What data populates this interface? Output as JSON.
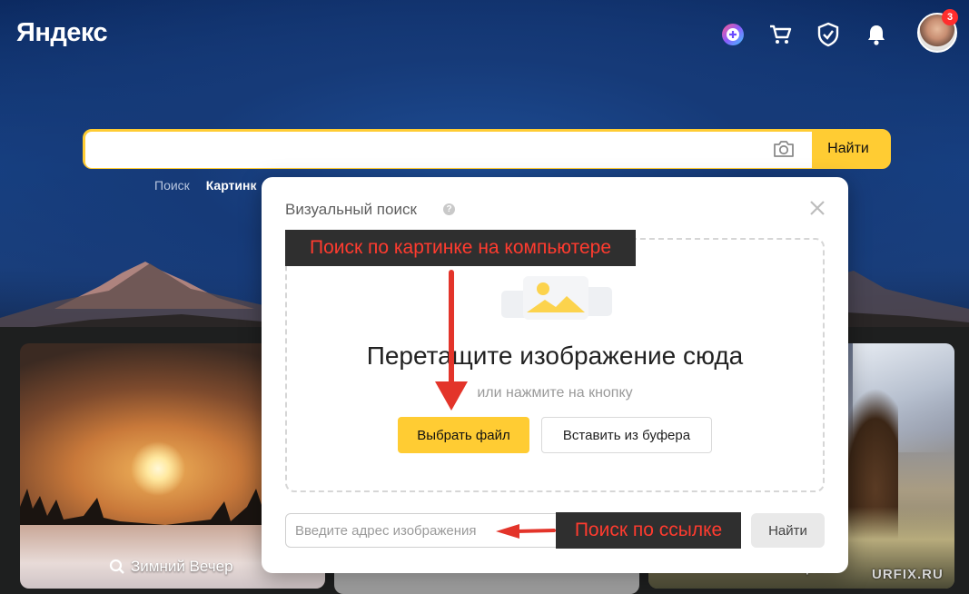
{
  "header": {
    "logo": "Яндекс",
    "icons": [
      "plus-circle-icon",
      "cart-icon",
      "shield-check-icon",
      "bell-icon"
    ],
    "notifications_count": "3"
  },
  "search": {
    "button_label": "Найти",
    "placeholder": ""
  },
  "tabs": [
    {
      "label": "Поиск"
    },
    {
      "label": "Картинк"
    }
  ],
  "cards": [
    {
      "caption": "Зимний Вечер"
    },
    {
      "caption": ""
    },
    {
      "caption": "рзли"
    }
  ],
  "visual_search": {
    "title": "Визуальный поиск",
    "help": "?",
    "drop_heading": "Перетащите изображение сюда",
    "drop_sub": "или нажмите на кнопку",
    "choose_file": "Выбрать файл",
    "paste": "Вставить из буфера",
    "url_placeholder": "Введите адрес изображения",
    "find": "Найти"
  },
  "annotations": {
    "computer": "Поиск по картинке на компьютере",
    "link": "Поиск по ссылке"
  },
  "watermark": "URFIX.RU",
  "colors": {
    "accent": "#ffcc33",
    "annotation_text": "#ff3b2f",
    "annotation_bg": "#2f2f2f",
    "arrow": "#e3342a"
  }
}
